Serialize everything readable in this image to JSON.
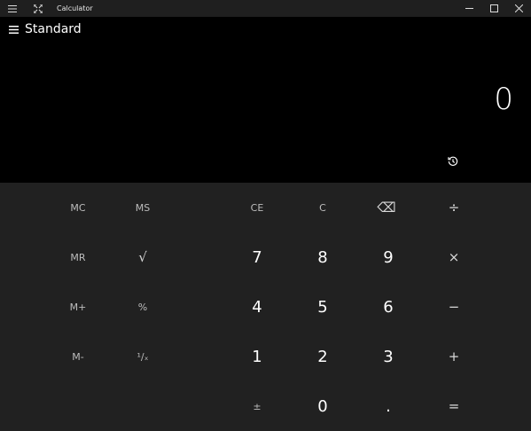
{
  "window": {
    "title": "Calculator"
  },
  "header": {
    "mode": "Standard"
  },
  "display": {
    "value": "0"
  },
  "keys": {
    "mc": "MC",
    "ms": "MS",
    "mr": "MR",
    "mplus": "M+",
    "mminus": "M-",
    "sqrt": "√",
    "percent": "%",
    "reciprocal": "¹∕ₓ",
    "ce": "CE",
    "c": "C",
    "backspace": "⌫",
    "divide": "÷",
    "multiply": "×",
    "minus": "−",
    "plus": "+",
    "equals": "=",
    "negate": "±",
    "decimal": ".",
    "seven": "7",
    "eight": "8",
    "nine": "9",
    "four": "4",
    "five": "5",
    "six": "6",
    "one": "1",
    "two": "2",
    "three": "3",
    "zero": "0"
  },
  "icons": {
    "menu": "hamburger-icon",
    "compact": "compact-overlay-icon",
    "minimize": "minimize-icon",
    "maximize": "maximize-icon",
    "close": "close-icon",
    "history": "history-icon"
  }
}
